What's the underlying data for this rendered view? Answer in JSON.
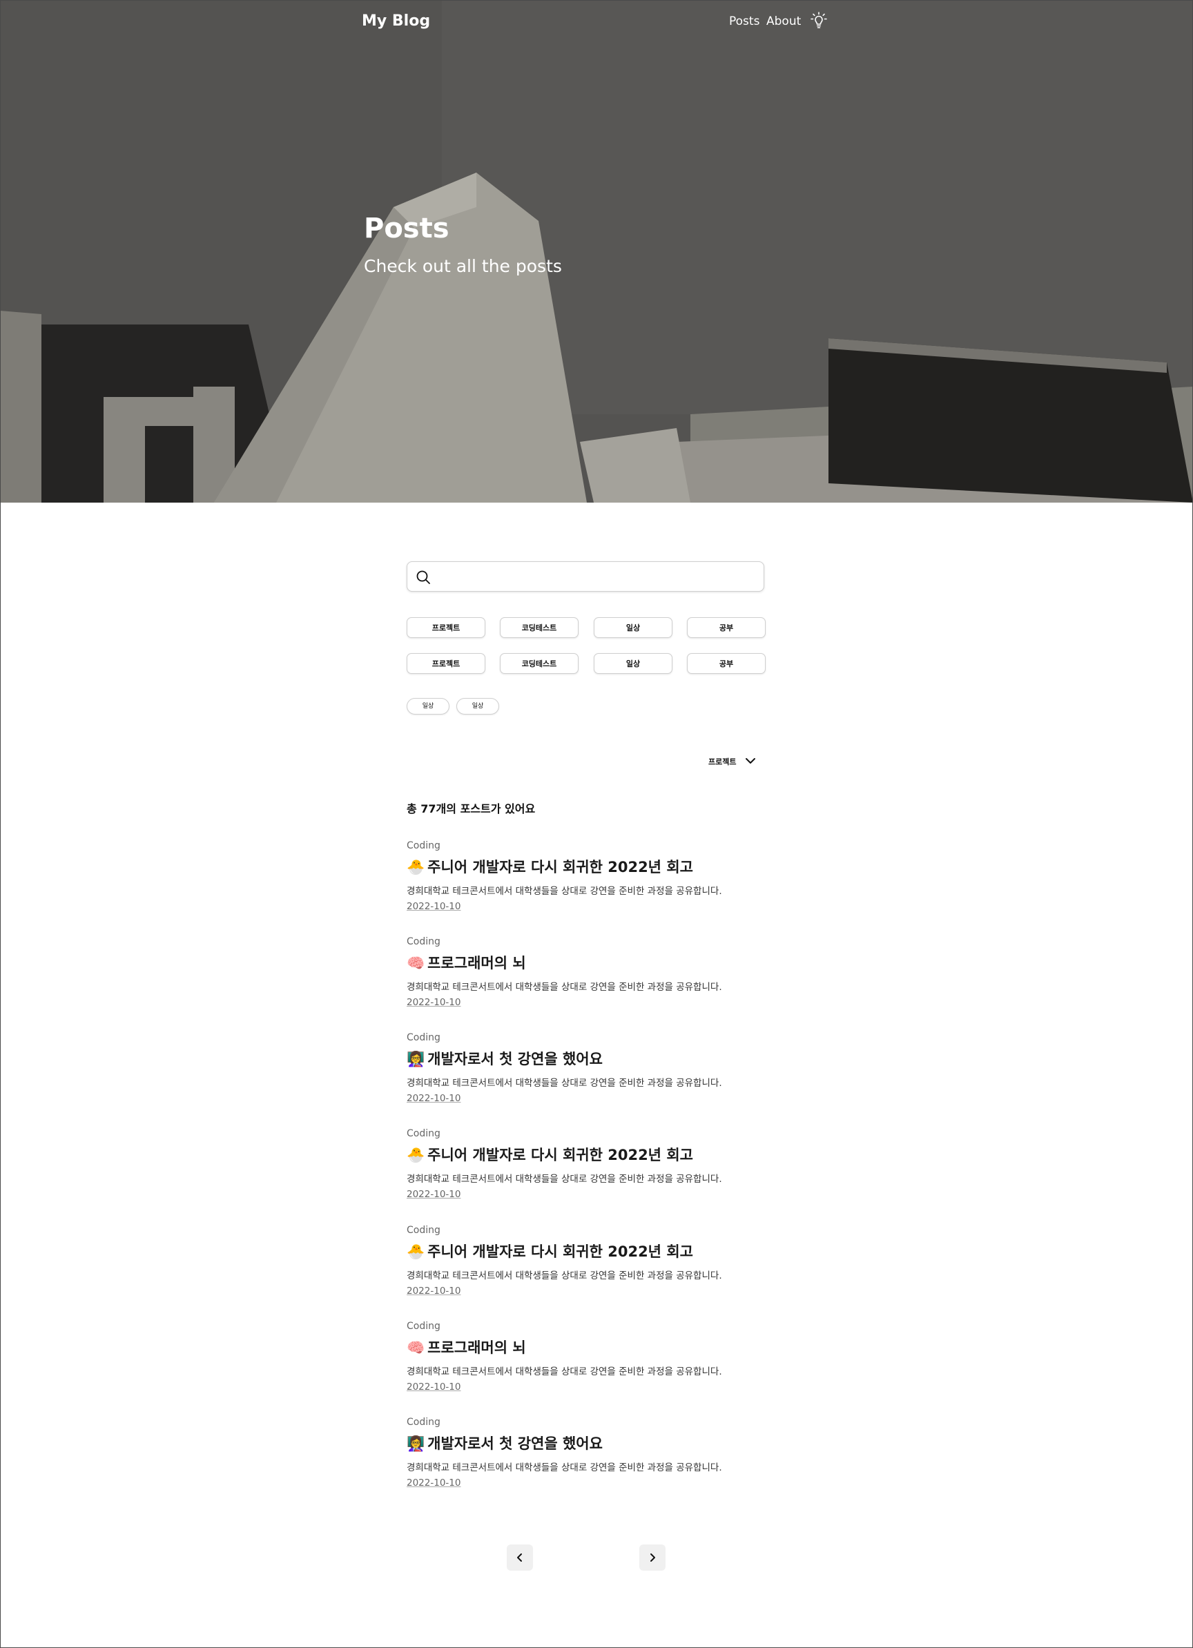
{
  "nav": {
    "brand": "My Blog",
    "links": [
      "Posts",
      "About"
    ],
    "theme_icon": "lightbulb-icon"
  },
  "hero": {
    "title": "Posts",
    "subtitle": "Check out all the posts"
  },
  "search": {
    "value": "",
    "placeholder": "",
    "icon": "search-icon"
  },
  "categories": [
    [
      "프로젝트",
      "코딩테스트",
      "일상",
      "공부"
    ],
    [
      "프로젝트",
      "코딩테스트",
      "일상",
      "공부"
    ]
  ],
  "tags": [
    "일상",
    "일상"
  ],
  "sort": {
    "selected": "프로젝트",
    "icon": "chevron-down-icon"
  },
  "total_label": "총 77개의 포스트가 있어요",
  "posts": [
    {
      "category": "Coding",
      "emoji": "🐣",
      "title": "주니어 개발자로 다시 회귀한 2022년 회고",
      "description": "경희대학교 테크콘서트에서 대학생들을 상대로 강연을 준비한 과정을 공유합니다.",
      "date": "2022-10-10"
    },
    {
      "category": "Coding",
      "emoji": "🧠",
      "title": "프로그래머의 뇌",
      "description": "경희대학교 테크콘서트에서 대학생들을 상대로 강연을 준비한 과정을 공유합니다.",
      "date": "2022-10-10"
    },
    {
      "category": "Coding",
      "emoji": "👩‍🏫",
      "title": "개발자로서 첫 강연을 했어요",
      "description": "경희대학교 테크콘서트에서 대학생들을 상대로 강연을 준비한 과정을 공유합니다.",
      "date": "2022-10-10"
    },
    {
      "category": "Coding",
      "emoji": "🐣",
      "title": "주니어 개발자로 다시 회귀한 2022년 회고",
      "description": "경희대학교 테크콘서트에서 대학생들을 상대로 강연을 준비한 과정을 공유합니다.",
      "date": "2022-10-10"
    },
    {
      "category": "Coding",
      "emoji": "🐣",
      "title": "주니어 개발자로 다시 회귀한 2022년 회고",
      "description": "경희대학교 테크콘서트에서 대학생들을 상대로 강연을 준비한 과정을 공유합니다.",
      "date": "2022-10-10"
    },
    {
      "category": "Coding",
      "emoji": "🧠",
      "title": "프로그래머의 뇌",
      "description": "경희대학교 테크콘서트에서 대학생들을 상대로 강연을 준비한 과정을 공유합니다.",
      "date": "2022-10-10"
    },
    {
      "category": "Coding",
      "emoji": "👩‍🏫",
      "title": "개발자로서 첫 강연을 했어요",
      "description": "경희대학교 테크콘서트에서 대학생들을 상대로 강연을 준비한 과정을 공유합니다.",
      "date": "2022-10-10"
    }
  ],
  "pagination": {
    "prev_icon": "chevron-left-icon",
    "next_icon": "chevron-right-icon"
  }
}
